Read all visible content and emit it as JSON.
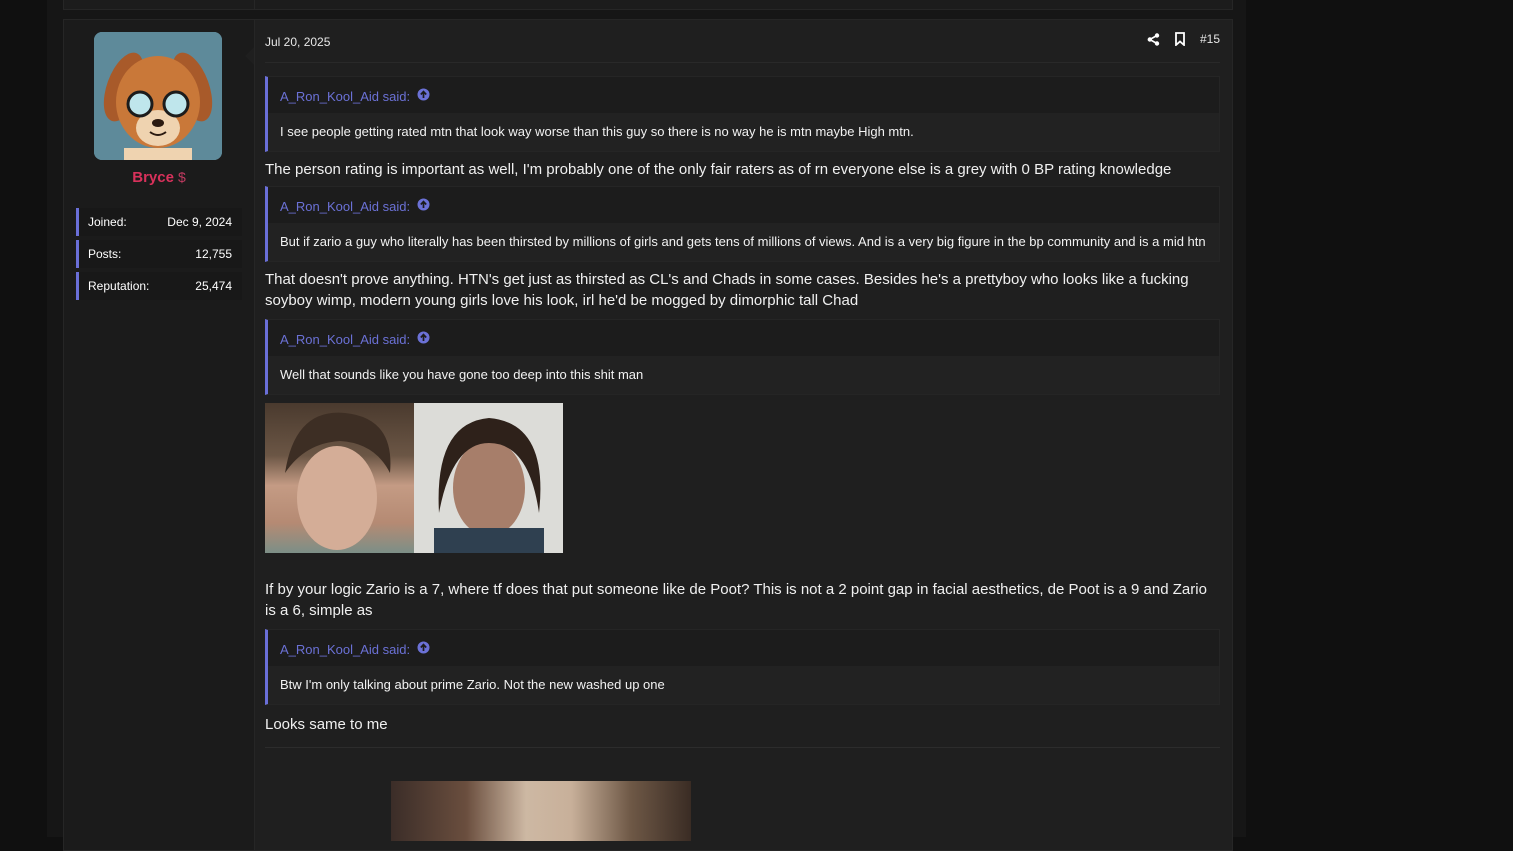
{
  "post": {
    "date": "Jul 20, 2025",
    "number": "#15",
    "user": {
      "name": "Bryce",
      "badge": "$",
      "stats": [
        {
          "label": "Joined:",
          "value": "Dec 9, 2024"
        },
        {
          "label": "Posts:",
          "value": "12,755"
        },
        {
          "label": "Reputation:",
          "value": "25,474"
        }
      ]
    },
    "blocks": {
      "q1": {
        "author": "A_Ron_Kool_Aid said:",
        "text": "I see people getting rated mtn that look way worse than this guy so there is no way he is mtn maybe High mtn."
      },
      "m1": "The person rating is important as well, I'm probably one of the only fair raters as of rn everyone else is a grey with 0 BP rating knowledge",
      "q2": {
        "author": "A_Ron_Kool_Aid said:",
        "text": "But if zario a guy who literally has been thirsted by millions of girls and gets tens of millions of views. And is a very big figure in the bp community and is a mid htn"
      },
      "m2": "That doesn't prove anything. HTN's get just as thirsted as CL's and Chads in some cases. Besides he's a prettyboy who looks like a fucking soyboy wimp, modern young girls love his look, irl he'd be mogged by dimorphic tall Chad",
      "q3": {
        "author": "A_Ron_Kool_Aid said:",
        "text": "Well that sounds like you have gone too deep into this shit man"
      },
      "m3": "If by your logic Zario is a 7, where tf does that put someone like de Poot? This is not a 2 point gap in facial aesthetics, de Poot is a 9 and Zario is a 6, simple as",
      "q4": {
        "author": "A_Ron_Kool_Aid said:",
        "text": "Btw I'm only talking about prime Zario. Not the new washed up one"
      },
      "m4": "Looks same to me"
    }
  },
  "colors": {
    "accent": "#6a6fd8",
    "username": "#d8315b",
    "background": "#1f1f1f"
  },
  "icons": [
    "share-icon",
    "bookmark-icon",
    "arrow-up-circle-icon"
  ]
}
